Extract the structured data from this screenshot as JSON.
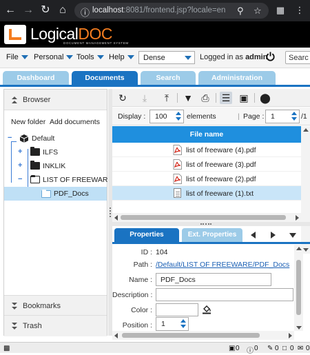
{
  "browser": {
    "url_host": "localhost",
    "url_rest": ":8081/frontend.jsp?locale=en"
  },
  "logo": {
    "word_logical": "Logical",
    "word_doc": "DOC",
    "tagline": "DOCUMENT MANAGEMENT SYSTEM"
  },
  "menu": {
    "file": "File",
    "personal": "Personal",
    "tools": "Tools",
    "help": "Help",
    "density": "Dense",
    "logged_in_prefix": "Logged in as",
    "user": "admin",
    "search_placeholder": "Searc"
  },
  "tabs": [
    {
      "label": "Dashboard"
    },
    {
      "label": "Documents"
    },
    {
      "label": "Search"
    },
    {
      "label": "Administration"
    }
  ],
  "left": {
    "browser_title": "Browser",
    "new_folder": "New folder",
    "add_documents": "Add documents",
    "tree": [
      {
        "label": "Default"
      },
      {
        "label": "ILFS"
      },
      {
        "label": "INKLIK"
      },
      {
        "label": "LIST OF FREEWARE"
      },
      {
        "label": "PDF_Docs"
      }
    ],
    "bookmarks": "Bookmarks",
    "trash": "Trash"
  },
  "display": {
    "display_label": "Display :",
    "page_size": "100",
    "elements_label": "elements",
    "page_label": "Page :",
    "page": "1",
    "page_total": "/1"
  },
  "files": {
    "header": "File name",
    "rows": [
      {
        "name": "list of freeware (4).pdf",
        "type": "pdf"
      },
      {
        "name": "list of freeware (3).pdf",
        "type": "pdf"
      },
      {
        "name": "list of freeware (2).pdf",
        "type": "pdf"
      },
      {
        "name": "list of freeware (1).txt",
        "type": "txt"
      }
    ]
  },
  "properties": {
    "tab_properties": "Properties",
    "tab_ext": "Ext. Properties",
    "id_label": "ID :",
    "id_value": "104",
    "path_label": "Path :",
    "path_value": "/Default/LIST OF FREEWARE/PDF_Docs",
    "name_label": "Name :",
    "name_value": "PDF_Docs",
    "description_label": "Description :",
    "description_value": "",
    "color_label": "Color :",
    "position_label": "Position :",
    "position_value": "1"
  },
  "statusbar": {
    "count_a": "0",
    "count_b": "0",
    "count_c": "0",
    "count_d": "0",
    "count_e": "0"
  },
  "colors": {
    "accent": "#1a73c2",
    "brand_orange": "#f47d20",
    "header_blue": "#1f8fde",
    "selection": "#c9e5f8"
  }
}
